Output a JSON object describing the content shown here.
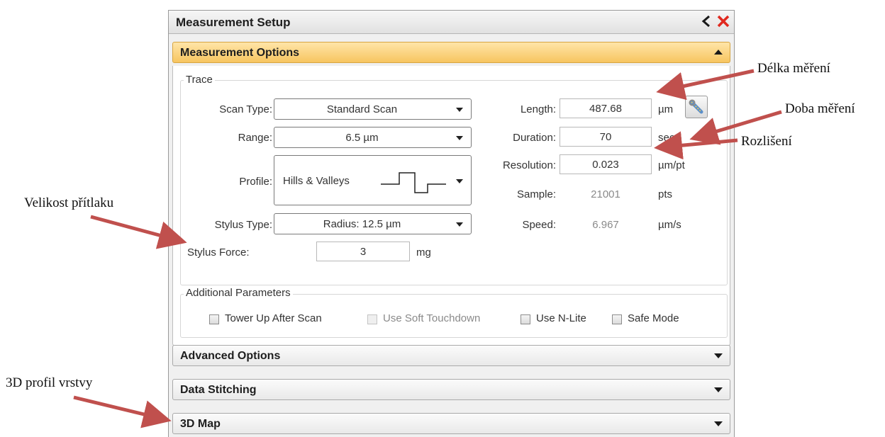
{
  "window": {
    "title": "Measurement Setup"
  },
  "sections": {
    "measurement_options": "Measurement Options",
    "advanced_options": "Advanced Options",
    "data_stitching": "Data Stitching",
    "map_3d": "3D Map"
  },
  "trace": {
    "legend": "Trace",
    "scan_type": {
      "label": "Scan Type:",
      "value": "Standard Scan"
    },
    "range": {
      "label": "Range:",
      "value": "6.5 µm"
    },
    "profile": {
      "label": "Profile:",
      "value": "Hills & Valleys"
    },
    "stylus_type": {
      "label": "Stylus Type:",
      "value": "Radius: 12.5 µm"
    },
    "stylus_force": {
      "label": "Stylus Force:",
      "value": "3",
      "unit": "mg"
    },
    "length": {
      "label": "Length:",
      "value": "487.68",
      "unit": "µm"
    },
    "duration": {
      "label": "Duration:",
      "value": "70",
      "unit": "sec"
    },
    "resolution": {
      "label": "Resolution:",
      "value": "0.023",
      "unit": "µm/pt"
    },
    "sample": {
      "label": "Sample:",
      "value": "21001",
      "unit": "pts"
    },
    "speed": {
      "label": "Speed:",
      "value": "6.967",
      "unit": "µm/s"
    }
  },
  "additional": {
    "legend": "Additional Parameters",
    "tower_up": {
      "label": "Tower Up After Scan",
      "checked": false,
      "enabled": true
    },
    "soft_touchdown": {
      "label": "Use Soft Touchdown",
      "checked": false,
      "enabled": false
    },
    "n_lite": {
      "label": "Use N-Lite",
      "checked": false,
      "enabled": true
    },
    "safe_mode": {
      "label": "Safe Mode",
      "checked": false,
      "enabled": true
    }
  },
  "annotations": {
    "delka": "Délka měření",
    "doba": "Doba měření",
    "rozliseni": "Rozlišení",
    "velikost": "Velikost přítlaku",
    "profil3d": "3D profil vrstvy"
  },
  "colors": {
    "accent_header": "#f7c560",
    "close": "#e0281e",
    "arrow": "#c0504d"
  }
}
